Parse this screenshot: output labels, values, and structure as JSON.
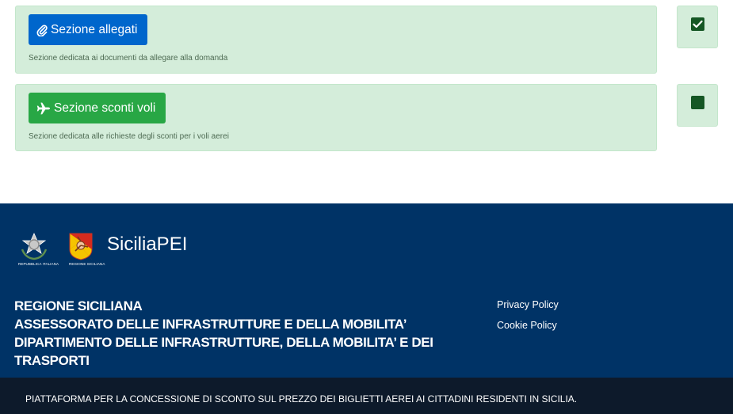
{
  "sections": [
    {
      "button_label": "Sezione allegati",
      "button_icon": "paperclip-icon",
      "description": "Sezione dedicata ai documenti da allegare alla domanda",
      "completed": true
    },
    {
      "button_label": "Sezione sconti voli",
      "button_icon": "airplane-icon",
      "description": "Sezione dedicata alle richieste degli sconti per i voli aerei",
      "completed": false
    }
  ],
  "footer": {
    "emblem_italy_caption": "REPUBBLICA ITALIANA",
    "emblem_sicily_caption": "REGIONE SICILIANA",
    "brand": "SiciliaPEI",
    "org_lines": [
      "REGIONE SICILIANA",
      "ASSESSORATO DELLE INFRASTRUTTURE E DELLA MOBILITA’",
      "DIPARTIMENTO DELLE INFRASTRUTTURE, DELLA MOBILITA’ E DEI",
      "TRASPORTI"
    ],
    "links": [
      "Privacy Policy",
      "Cookie Policy"
    ],
    "tagline": "PIATTAFORMA PER LA CONCESSIONE DI SCONTO SUL PREZZO DEI BIGLIETTI AEREI AI CITTADINI RESIDENTI IN SICILIA."
  },
  "colors": {
    "primary_blue": "#0066cc",
    "success_green": "#28a745",
    "card_bg": "#d4edda",
    "footer_bg": "#003366",
    "bottom_bar_bg": "#0d1a2b"
  }
}
